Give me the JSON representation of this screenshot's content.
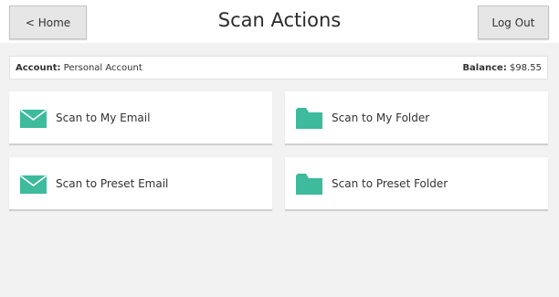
{
  "header": {
    "home_label": "< Home",
    "title": "Scan Actions",
    "logout_label": "Log Out"
  },
  "account": {
    "account_key": "Account:",
    "account_value": "Personal Account",
    "balance_key": "Balance:",
    "balance_value": "$98.55"
  },
  "actions": [
    {
      "label": "Scan to My Email",
      "icon": "envelope-icon"
    },
    {
      "label": "Scan to My Folder",
      "icon": "folder-icon"
    },
    {
      "label": "Scan to Preset Email",
      "icon": "envelope-icon"
    },
    {
      "label": "Scan to Preset Folder",
      "icon": "folder-icon"
    }
  ],
  "colors": {
    "accent": "#3dbb9c",
    "background": "#f2f2f2",
    "button": "#e6e6e6"
  }
}
